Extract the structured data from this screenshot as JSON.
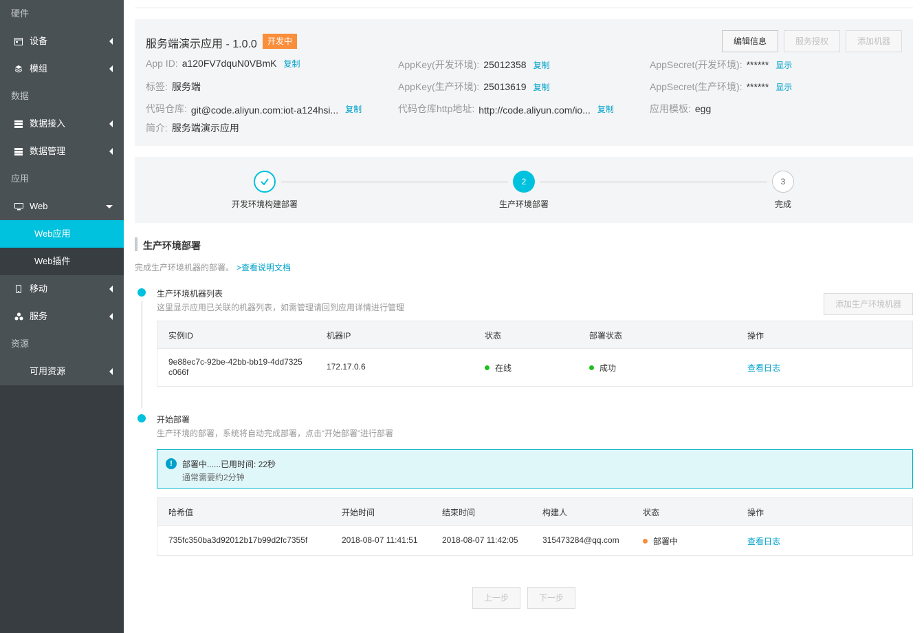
{
  "sidebar": {
    "group_hardware": "硬件",
    "device": "设备",
    "module": "模组",
    "group_data": "数据",
    "data_access": "数据接入",
    "data_manage": "数据管理",
    "group_app": "应用",
    "web": "Web",
    "web_app": "Web应用",
    "web_plugin": "Web插件",
    "mobile": "移动",
    "service": "服务",
    "group_resource": "资源",
    "available_resource": "可用资源"
  },
  "app": {
    "title": "服务端演示应用 - 1.0.0",
    "status": "开发中",
    "edit_button": "编辑信息",
    "auth_button": "服务授权",
    "add_machine_button": "添加机器",
    "app_id_label": "App ID:",
    "app_id": "a120FV7dquN0VBmK",
    "appkey_dev_label": "AppKey(开发环境):",
    "appkey_dev": "25012358",
    "appsecret_dev_label": "AppSecret(开发环境):",
    "appsecret_dev": "******",
    "tag_label": "标签:",
    "tag": "服务端",
    "appkey_prod_label": "AppKey(生产环境):",
    "appkey_prod": "25013619",
    "appsecret_prod_label": "AppSecret(生产环境):",
    "appsecret_prod": "******",
    "repo_label": "代码仓库:",
    "repo": "git@code.aliyun.com:iot-a124hsi...",
    "repo_http_label": "代码仓库http地址:",
    "repo_http": "http://code.aliyun.com/io...",
    "template_label": "应用模板:",
    "template": "egg",
    "intro_label": "简介:",
    "intro": "服务端演示应用",
    "copy": "复制",
    "show": "显示"
  },
  "steps": [
    {
      "label": "开发环境构建部署",
      "index": "1",
      "state": "done"
    },
    {
      "label": "生产环境部署",
      "index": "2",
      "state": "active"
    },
    {
      "label": "完成",
      "index": "3",
      "state": "pending"
    }
  ],
  "section": {
    "title": "生产环境部署",
    "desc": "完成生产环境机器的部署。",
    "doc_link": ">查看说明文档"
  },
  "machines": {
    "title": "生产环境机器列表",
    "desc": "这里显示应用已关联的机器列表，如需管理请回到应用详情进行管理",
    "add_button": "添加生产环境机器",
    "headers": [
      "实例ID",
      "机器IP",
      "状态",
      "部署状态",
      "操作"
    ],
    "rows": [
      {
        "id_line1": "9e88ec7c-92be-42bb-bb19-4dd7325",
        "id_line2": "c066f",
        "ip": "172.17.0.6",
        "status": "在线",
        "deploy_status": "成功",
        "action": "查看日志"
      }
    ]
  },
  "deploy": {
    "title": "开始部署",
    "desc": "生产环境的部署，系统将自动完成部署，点击“开始部署”进行部署",
    "alert_title": "部署中......已用时间: 22秒",
    "alert_sub": "通常需要约2分钟",
    "headers": [
      "哈希值",
      "开始时间",
      "结束时间",
      "构建人",
      "状态",
      "操作"
    ],
    "rows": [
      {
        "hash": "735fc350ba3d92012b17b99d2fc7355f",
        "start": "2018-08-07 11:41:51",
        "end": "2018-08-07 11:42:05",
        "builder": "315473284@qq.com",
        "status": "部署中",
        "action": "查看日志"
      }
    ]
  },
  "footer": {
    "prev": "上一步",
    "next": "下一步"
  },
  "colors": {
    "accent": "#00c1de",
    "link": "#00a2ca",
    "success": "#1dc11d",
    "warning": "#f98e3b"
  }
}
